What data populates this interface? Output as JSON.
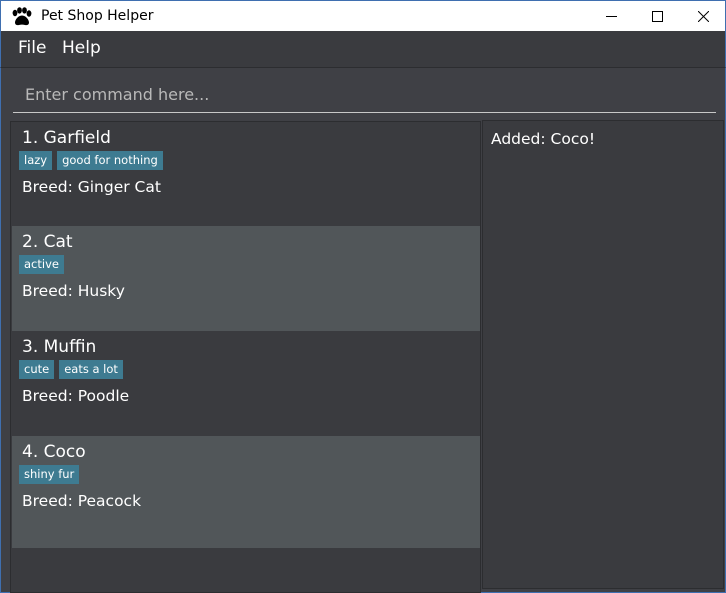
{
  "window": {
    "title": "Pet Shop Helper",
    "icon": "paw-icon",
    "controls": [
      "minimize-icon",
      "maximize-icon",
      "close-icon"
    ]
  },
  "menu": {
    "file_label": "File",
    "help_label": "Help"
  },
  "command": {
    "placeholder": "Enter command here...",
    "value": ""
  },
  "pets": [
    {
      "index_name": "1. Garfield",
      "tags": [
        "lazy",
        "good for nothing"
      ],
      "breed": "Breed: Ginger Cat"
    },
    {
      "index_name": "2. Cat",
      "tags": [
        "active"
      ],
      "breed": "Breed: Husky"
    },
    {
      "index_name": "3. Muffin",
      "tags": [
        "cute",
        "eats a lot"
      ],
      "breed": "Breed: Poodle"
    },
    {
      "index_name": "4. Coco",
      "tags": [
        "shiny fur"
      ],
      "breed": "Breed: Peacock"
    }
  ],
  "result": {
    "message": "Added: Coco!"
  },
  "colors": {
    "background": "#3f4045",
    "card_dark": "#3a3b3f",
    "card_light": "#515659",
    "tag": "#3e7b91",
    "text": "#ffffff"
  }
}
